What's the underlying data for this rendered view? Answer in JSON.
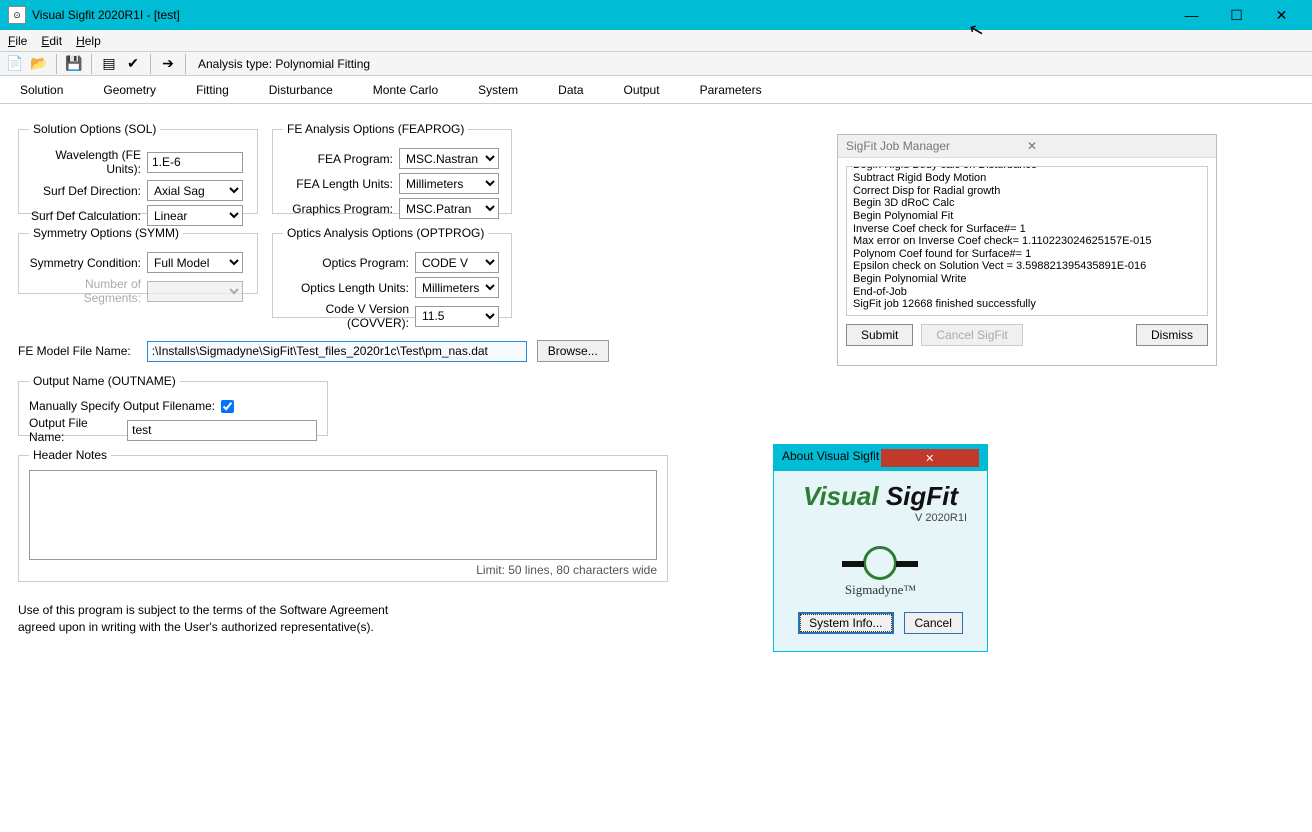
{
  "window": {
    "title": "Visual Sigfit 2020R1I - [test]",
    "iconTxt": "⊙"
  },
  "menu": {
    "file": "File",
    "edit": "Edit",
    "help": "Help"
  },
  "toolbar": {
    "analysis": "Analysis type: Polynomial Fitting"
  },
  "tabs": {
    "solution": "Solution",
    "geometry": "Geometry",
    "fitting": "Fitting",
    "disturbance": "Disturbance",
    "monteCarlo": "Monte Carlo",
    "system": "System",
    "data": "Data",
    "output": "Output",
    "parameters": "Parameters"
  },
  "sol": {
    "legend": "Solution Options (SOL)",
    "wavelengthL": "Wavelength (FE Units):",
    "wavelengthV": "1.E-6",
    "surfDirL": "Surf Def Direction:",
    "surfDirV": "Axial Sag",
    "surfCalcL": "Surf Def Calculation:",
    "surfCalcV": "Linear"
  },
  "symm": {
    "legend": "Symmetry Options (SYMM)",
    "conditionL": "Symmetry Condition:",
    "conditionV": "Full Model",
    "segmentsL": "Number of Segments:"
  },
  "fea": {
    "legend": "FE Analysis Options (FEAPROG)",
    "progL": "FEA Program:",
    "progV": "MSC.Nastran",
    "lenL": "FEA Length Units:",
    "lenV": "Millimeters",
    "gfxL": "Graphics Program:",
    "gfxV": "MSC.Patran"
  },
  "opt": {
    "legend": "Optics Analysis Options (OPTPROG)",
    "progL": "Optics Program:",
    "progV": "CODE V",
    "lenL": "Optics Length Units:",
    "lenV": "Millimeters",
    "cvvL": "Code V Version (COVVER):",
    "cvvV": "11.5"
  },
  "feModel": {
    "label": "FE Model File Name:",
    "value": ":\\Installs\\Sigmadyne\\SigFit\\Test_files_2020r1c\\Test\\pm_nas.dat",
    "browse": "Browse..."
  },
  "outname": {
    "legend": "Output Name (OUTNAME)",
    "manualL": "Manually Specify Output Filename:",
    "outL": "Output File Name:",
    "outV": "test"
  },
  "header": {
    "legend": "Header Notes",
    "limit": "Limit: 50 lines, 80 characters wide"
  },
  "footer": {
    "l1": "Use of this program is subject to the terms of the Software Agreement",
    "l2": "agreed upon in writing with the User's authorized representative(s)."
  },
  "jm": {
    "title": "SigFit Job Manager",
    "log": [
      "Begin Rigid Body calc on Disturbance",
      "Subtract Rigid Body Motion",
      "Correct Disp for Radial growth",
      "Begin 3D dRoC Calc",
      "Begin Polynomial Fit",
      "Inverse Coef check for Surface#=            1",
      "Max error on Inverse Coef check=  1.110223024625157E-015",
      "Polynom Coef found for Surface#=            1",
      "Epsilon check on Solution Vect =  3.598821395435891E-016",
      "Begin Polynomial Write",
      "End-of-Job",
      "SigFit job 12668 finished successfully"
    ],
    "submit": "Submit",
    "cancel": "Cancel SigFit",
    "dismiss": "Dismiss"
  },
  "about": {
    "title": "About Visual Sigfit",
    "name1": "Visual ",
    "name2": "SigFit",
    "version": "V 2020R1I",
    "company": "Sigmadyne™",
    "sysinfo": "System Info...",
    "cancel": "Cancel"
  }
}
